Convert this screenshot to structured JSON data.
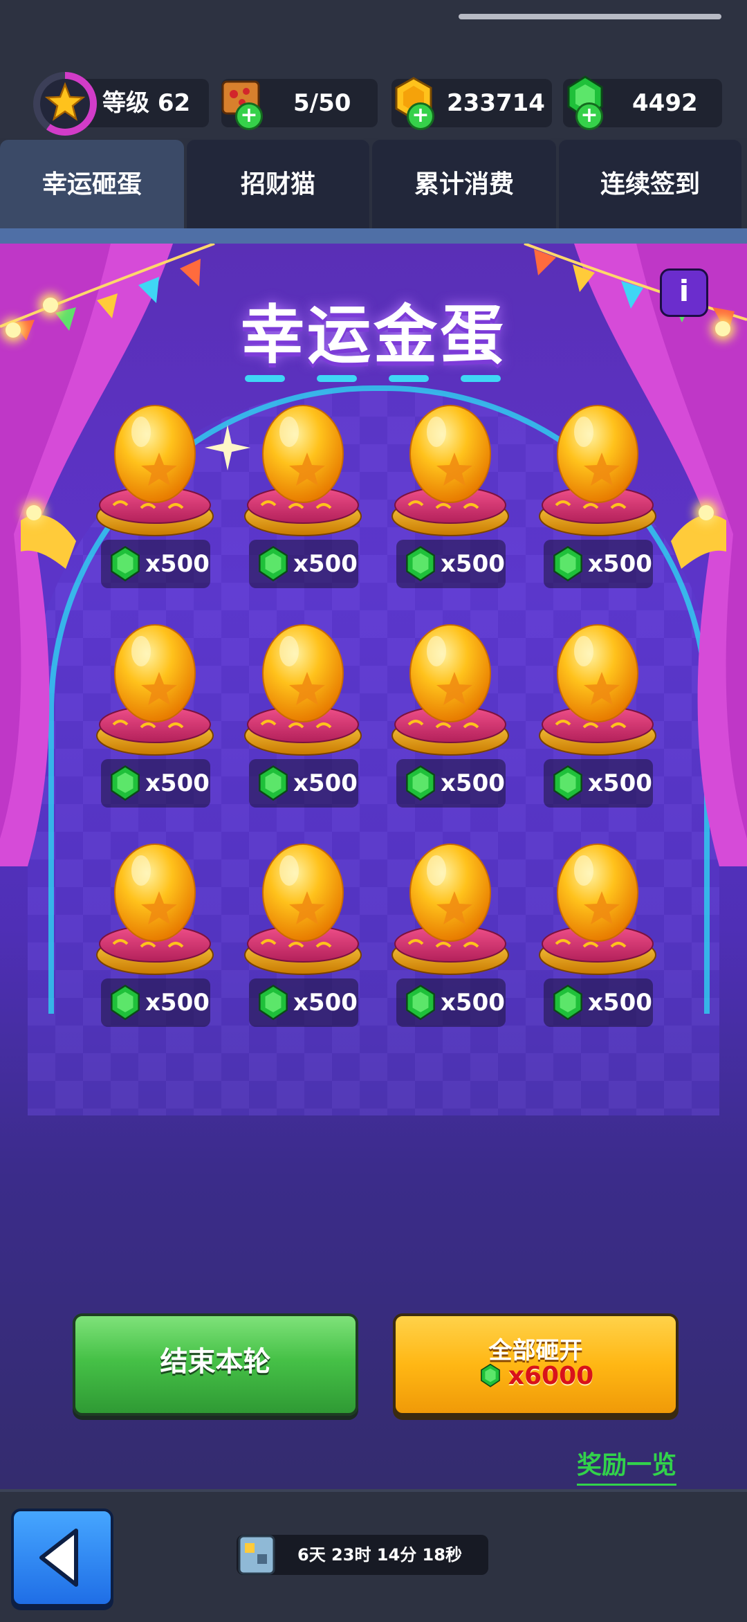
{
  "header": {
    "level_label": "等级 62",
    "pizza_count": "5/50",
    "coins": "233714",
    "gems": "4492"
  },
  "tabs": [
    {
      "label": "幸运砸蛋",
      "active": true
    },
    {
      "label": "招财猫",
      "active": false
    },
    {
      "label": "累计消费",
      "active": false
    },
    {
      "label": "连续签到",
      "active": false
    }
  ],
  "stage": {
    "title": "幸运金蛋",
    "info_label": "i"
  },
  "eggs": [
    {
      "price": "x500"
    },
    {
      "price": "x500"
    },
    {
      "price": "x500"
    },
    {
      "price": "x500"
    },
    {
      "price": "x500"
    },
    {
      "price": "x500"
    },
    {
      "price": "x500"
    },
    {
      "price": "x500"
    },
    {
      "price": "x500"
    },
    {
      "price": "x500"
    },
    {
      "price": "x500"
    },
    {
      "price": "x500"
    }
  ],
  "actions": {
    "end_round_label": "结束本轮",
    "smash_all_label": "全部砸开",
    "smash_all_cost": "x6000",
    "rewards_link": "奖励一览"
  },
  "footer": {
    "timer": "6天 23时 14分 18秒"
  },
  "colors": {
    "gem": "#1fc03a",
    "egg_gold": "#ffb81f",
    "accent_green": "#32d24b",
    "accent_orange": "#ffb714"
  }
}
